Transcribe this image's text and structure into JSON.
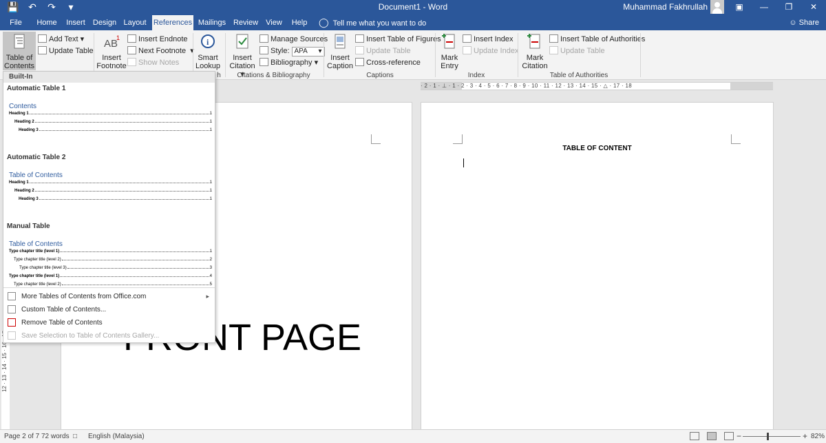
{
  "window": {
    "title": "Document1 - Word",
    "user": "Muhammad Fakhrullah",
    "share_label": "Share"
  },
  "tabs": [
    "File",
    "Home",
    "Insert",
    "Design",
    "Layout",
    "References",
    "Mailings",
    "Review",
    "View",
    "Help"
  ],
  "active_tab": "References",
  "tellme": "Tell me what you want to do",
  "ribbon": {
    "toc": {
      "button_line1": "Table of",
      "button_line2": "Contents",
      "add_text": "Add Text",
      "update_table": "Update Table"
    },
    "footnotes": {
      "insert_footnote_line1": "Insert",
      "insert_footnote_line2": "Footnote",
      "insert_endnote": "Insert Endnote",
      "next_footnote": "Next Footnote",
      "show_notes": "Show Notes"
    },
    "research": {
      "smart_lookup_line1": "Smart",
      "smart_lookup_line2": "Lookup",
      "group_label_partial": "h"
    },
    "citations": {
      "insert_citation_line1": "Insert",
      "insert_citation_line2": "Citation",
      "manage_sources": "Manage Sources",
      "style_label": "Style:",
      "style_value": "APA",
      "bibliography": "Bibliography",
      "group_label": "Citations & Bibliography"
    },
    "captions": {
      "insert_caption_line1": "Insert",
      "insert_caption_line2": "Caption",
      "insert_table_of_figures": "Insert Table of Figures",
      "update_table": "Update Table",
      "cross_reference": "Cross-reference",
      "group_label": "Captions"
    },
    "index": {
      "mark_entry_line1": "Mark",
      "mark_entry_line2": "Entry",
      "insert_index": "Insert Index",
      "update_index": "Update Index",
      "group_label": "Index"
    },
    "authorities": {
      "mark_citation_line1": "Mark",
      "mark_citation_line2": "Citation",
      "insert_table_of_authorities": "Insert Table of Authorities",
      "update_table": "Update Table",
      "group_label": "Table of Authorities"
    }
  },
  "toc_gallery": {
    "section_header": "Built-In",
    "items": [
      {
        "title": "Automatic Table 1",
        "heading": "Contents",
        "lines": [
          {
            "text": "Heading 1",
            "num": "1"
          },
          {
            "text": "Heading 2",
            "num": "1"
          },
          {
            "text": "Heading 3",
            "num": "1"
          }
        ]
      },
      {
        "title": "Automatic Table 2",
        "heading": "Table of Contents",
        "lines": [
          {
            "text": "Heading 1",
            "num": "1"
          },
          {
            "text": "Heading 2",
            "num": "1"
          },
          {
            "text": "Heading 3",
            "num": "1"
          }
        ]
      },
      {
        "title": "Manual Table",
        "heading": "Table of Contents",
        "lines": [
          {
            "text": "Type chapter title (level 1)",
            "num": "1"
          },
          {
            "text": "Type chapter title (level 2)",
            "num": "2"
          },
          {
            "text": "Type chapter title (level 3)",
            "num": "3"
          },
          {
            "text": "Type chapter title (level 1)",
            "num": "4"
          },
          {
            "text": "Type chapter title (level 2)",
            "num": "5"
          }
        ]
      }
    ],
    "menu": {
      "more_tables": "More Tables of Contents from Office.com",
      "custom_table": "Custom Table of Contents...",
      "remove_table": "Remove Table of Contents",
      "save_selection": "Save Selection to Table of Contents Gallery..."
    }
  },
  "document": {
    "front_page_text": "FRONT PAGE",
    "toc_title": "TABLE OF CONTENT"
  },
  "ruler": {
    "horizontal": "· 2 · 1 · ⊥ · 1 · 2 · 3 · 4 · 5 · 6 · 7 · 8 · 9 · 10 · 11 · 12 · 13 · 14 · 15 · △ · 17 · 18",
    "vertical": "12 · 13 · 14 · 15 · 16 · 17"
  },
  "statusbar": {
    "page": "Page 2 of 7",
    "words": "72 words",
    "language": "English (Malaysia)",
    "zoom": "82%",
    "zoom_minus": "−",
    "zoom_plus": "+"
  },
  "colors": {
    "titlebar": "#2b579a",
    "ribbon": "#f3f3f3",
    "toc_heading_blue": "#2e5b9e"
  }
}
